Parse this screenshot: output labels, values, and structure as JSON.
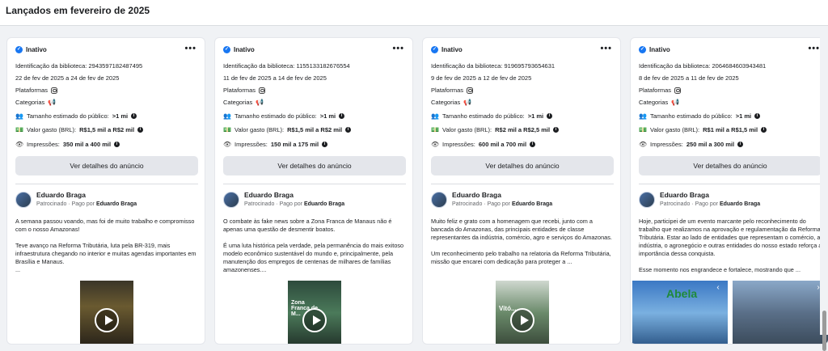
{
  "page": {
    "title": "Lançados em fevereiro de 2025"
  },
  "cards": [
    {
      "status": "Inativo",
      "library_id": "Identificação da biblioteca: 2943597182487495",
      "dates": "22 de fev de 2025 a 24 de fev de 2025",
      "platforms_label": "Plataformas",
      "categories_label": "Categorias",
      "audience_label": "Tamanho estimado do público:",
      "audience_value": ">1 mi",
      "spend_label": "Valor gasto (BRL):",
      "spend_value": "R$1,5 mil a R$2 mil",
      "impressions_label": "Impressões:",
      "impressions_value": "350 mil a 400 mil",
      "details_button": "Ver detalhes do anúncio",
      "advertiser": "Eduardo Braga",
      "sponsored": "Patrocinado",
      "paid_by": "· Pago por",
      "payer": "Eduardo Braga",
      "text": [
        "A semana passou voando, mas foi de muito trabalho e compromisso com o nosso Amazonas!",
        "Teve avanço na Reforma Tributária, luta pela BR-319, mais infraestrutura chegando no interior e muitas agendas importantes em Brasília e Manaus.",
        "..."
      ]
    },
    {
      "status": "Inativo",
      "library_id": "Identificação da biblioteca: 1155133182676554",
      "dates": "11 de fev de 2025 a 14 de fev de 2025",
      "platforms_label": "Plataformas",
      "categories_label": "Categorias",
      "audience_label": "Tamanho estimado do público:",
      "audience_value": ">1 mi",
      "spend_label": "Valor gasto (BRL):",
      "spend_value": "R$1,5 mil a R$2 mil",
      "impressions_label": "Impressões:",
      "impressions_value": "150 mil a 175 mil",
      "details_button": "Ver detalhes do anúncio",
      "advertiser": "Eduardo Braga",
      "sponsored": "Patrocinado",
      "paid_by": "· Pago por",
      "payer": "Eduardo Braga",
      "text": [
        "O combate às fake news sobre a Zona Franca de Manaus não é apenas uma questão de desmentir boatos.",
        "É uma luta histórica pela verdade, pela permanência do mais exitoso modelo econômico sustentável do mundo e, principalmente, pela manutenção dos empregos de centenas de milhares de famílias amazonenses...."
      ]
    },
    {
      "status": "Inativo",
      "library_id": "Identificação da biblioteca: 919695793654631",
      "dates": "9 de fev de 2025 a 12 de fev de 2025",
      "platforms_label": "Plataformas",
      "categories_label": "Categorias",
      "audience_label": "Tamanho estimado do público:",
      "audience_value": ">1 mi",
      "spend_label": "Valor gasto (BRL):",
      "spend_value": "R$2 mil a R$2,5 mil",
      "impressions_label": "Impressões:",
      "impressions_value": "600 mil a 700 mil",
      "details_button": "Ver detalhes do anúncio",
      "advertiser": "Eduardo Braga",
      "sponsored": "Patrocinado",
      "paid_by": "· Pago por",
      "payer": "Eduardo Braga",
      "text": [
        "Muito feliz e grato com a homenagem que recebi, junto com a bancada do Amazonas, das principais entidades de classe representantes da indústria, comércio, agro e serviços do Amazonas.",
        "Um reconhecimento pelo trabalho na relatoria da Reforma Tributária, missão que encarei com dedicação para proteger a ..."
      ]
    },
    {
      "status": "Inativo",
      "library_id": "Identificação da biblioteca: 2064684603943481",
      "dates": "8 de fev de 2025 a 11 de fev de 2025",
      "platforms_label": "Plataformas",
      "categories_label": "Categorias",
      "audience_label": "Tamanho estimado do público:",
      "audience_value": ">1 mi",
      "spend_label": "Valor gasto (BRL):",
      "spend_value": "R$1 mil a R$1,5 mil",
      "impressions_label": "Impressões:",
      "impressions_value": "250 mil a 300 mil",
      "details_button": "Ver detalhes do anúncio",
      "advertiser": "Eduardo Braga",
      "sponsored": "Patrocinado",
      "paid_by": "· Pago por",
      "payer": "Eduardo Braga",
      "text": [
        "Hoje, participei de um evento marcante pelo reconhecimento do trabalho que realizamos na aprovação e regulamentação da Reforma Tributária. Estar ao lado de entidades que representam o comércio, a indústria, o agronegócio e outras entidades do nosso estado reforça a importância dessa conquista.",
        "Esse momento nos engrandece e fortalece, mostrando que ..."
      ]
    }
  ],
  "icons": {
    "status": "verified-check-icon",
    "more": "more-options-icon",
    "platform": "instagram-icon",
    "category": "megaphone-icon",
    "audience": "people-icon",
    "spend": "money-icon",
    "impressions": "eye-icon",
    "info": "info-icon",
    "play": "play-icon"
  },
  "media_text": {
    "card2_overlay": "Zona Franca de M...",
    "card3_overlay": "Vitó...",
    "card4_overlay": "Abela"
  },
  "colors": {
    "accent": "#1877f2",
    "background": "#f0f2f5",
    "button": "#e4e6eb"
  }
}
